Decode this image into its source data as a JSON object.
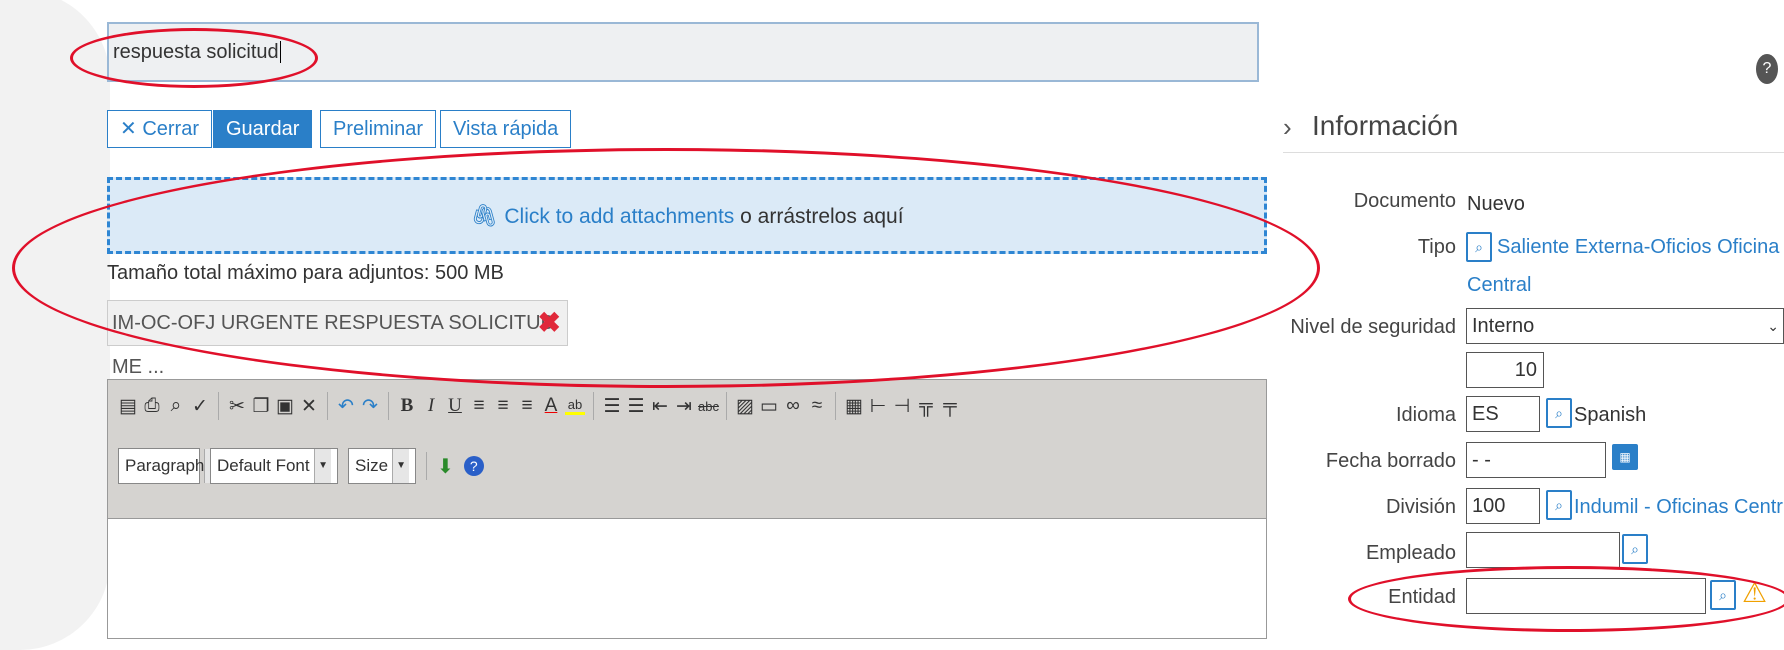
{
  "subject": {
    "value": "respuesta solicitud"
  },
  "toolbar": {
    "close_label": "Cerrar",
    "save_label": "Guardar",
    "preliminary_label": "Preliminar",
    "quick_view_label": "Vista rápida"
  },
  "attachments": {
    "link_text": "Click to add attachments",
    "drop_text": " o arrástrelos aquí",
    "max_size_text": "Tamaño total máximo para adjuntos: 500 MB",
    "files": [
      {
        "name": "IM-OC-OFJ URGENTE RESPUESTA SOLICITUD ME ..."
      }
    ]
  },
  "editor": {
    "format_select": "Paragraph",
    "font_select": "Default Font",
    "size_select": "Size"
  },
  "info": {
    "title": "Información",
    "documento_label": "Documento",
    "documento_value": "Nuevo",
    "tipo_label": "Tipo",
    "tipo_value_line1": "Saliente Externa-Oficios Oficina",
    "tipo_value_line2": "Central",
    "nivel_label": "Nivel de seguridad",
    "nivel_value": "Interno",
    "nivel_number": "10",
    "idioma_label": "Idioma",
    "idioma_code": "ES",
    "idioma_name": "Spanish",
    "fecha_label": "Fecha borrado",
    "fecha_value": "- -",
    "division_label": "División",
    "division_code": "100",
    "division_name": "Indumil - Oficinas Centr",
    "empleado_label": "Empleado",
    "empleado_value": "",
    "entidad_label": "Entidad",
    "entidad_value": ""
  },
  "icons": {
    "help": "?",
    "close": "✕",
    "remove": "✖",
    "attach_clip": "📎",
    "chevron_right": "›",
    "warning": "⚠"
  },
  "colors": {
    "accent": "#2a7fc8",
    "annotation_red": "#e0102a",
    "attach_bg": "#dbeaf7",
    "remove_red": "#e0283a"
  }
}
